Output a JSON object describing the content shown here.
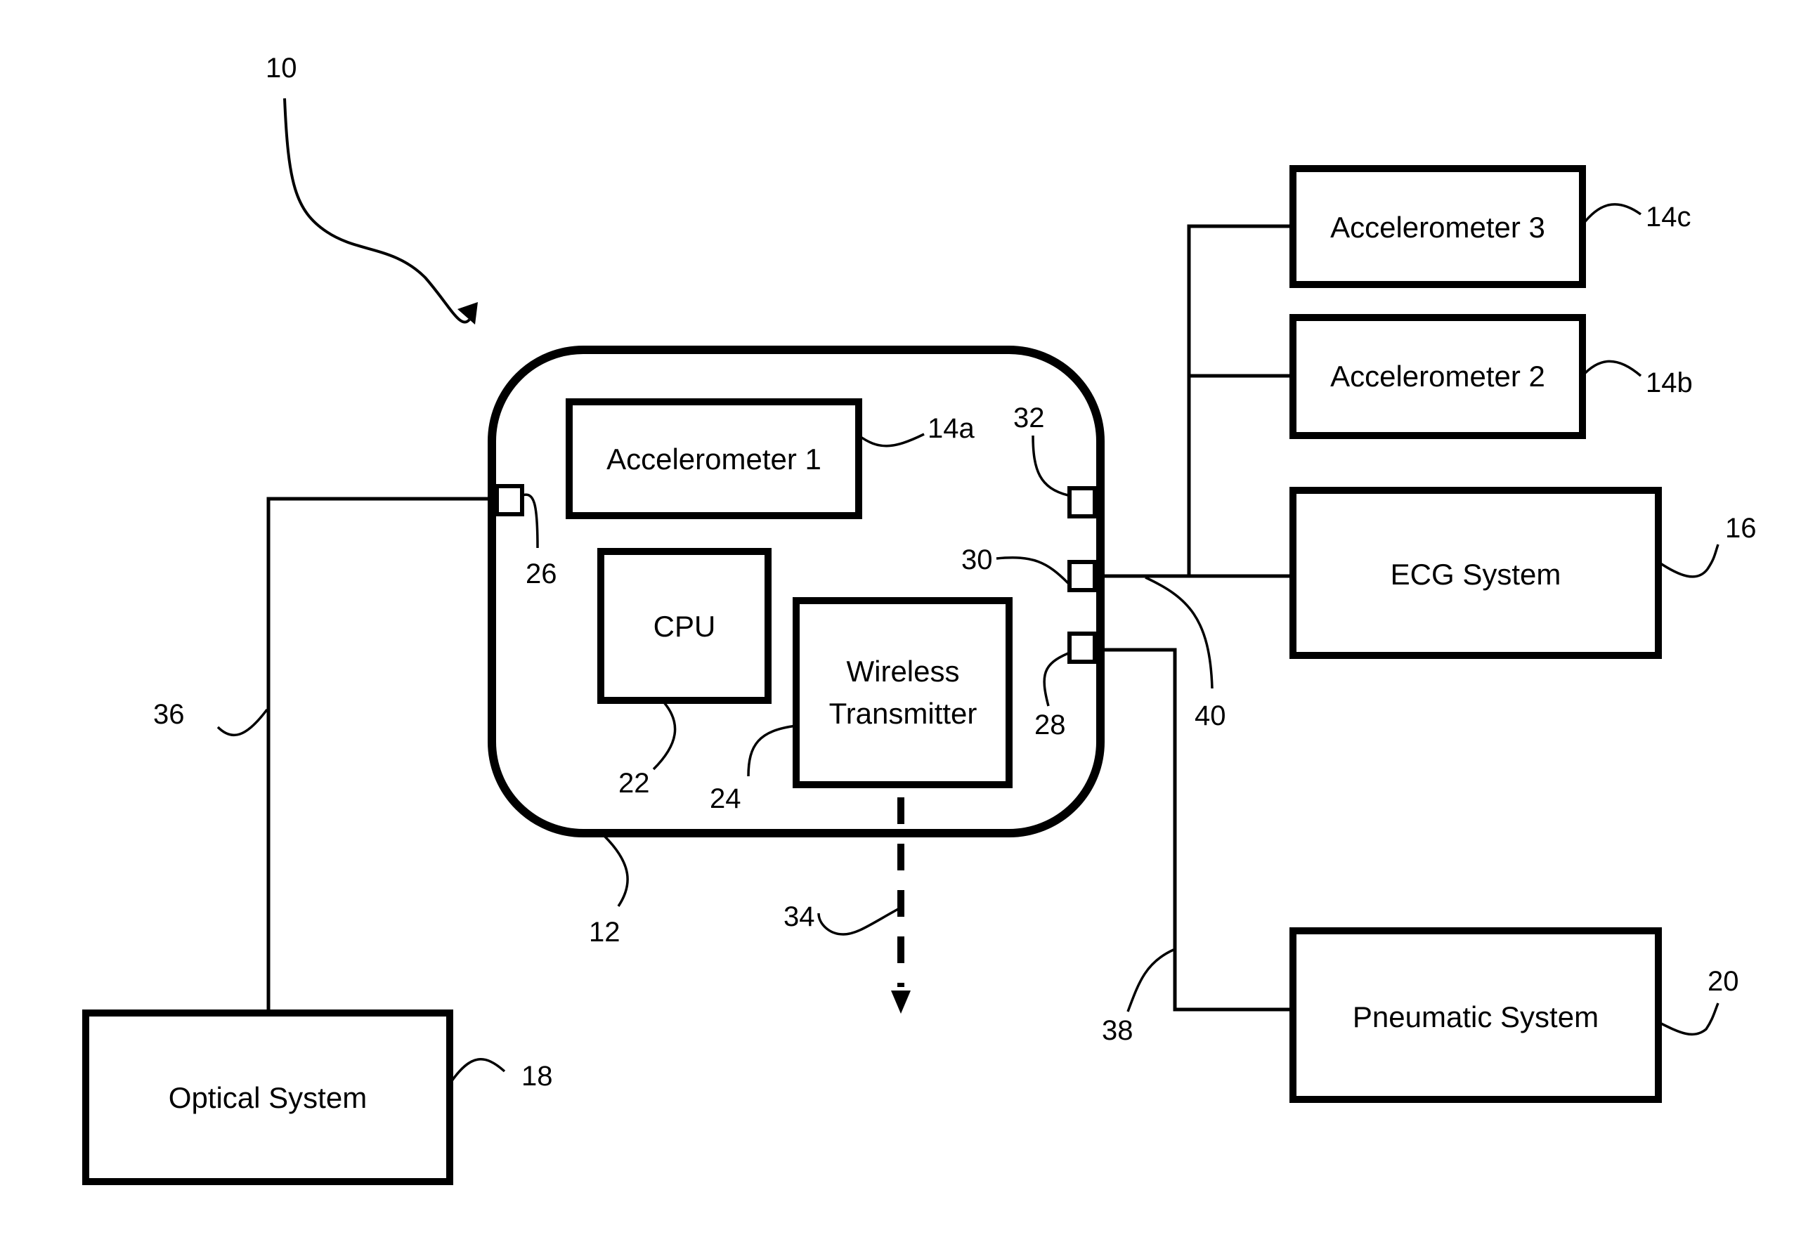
{
  "figure": {
    "system_ref": "10",
    "device": {
      "ref": "12"
    },
    "components": {
      "accel1": {
        "label": "Accelerometer 1",
        "ref": "14a"
      },
      "accel2": {
        "label": "Accelerometer 2",
        "ref": "14b"
      },
      "accel3": {
        "label": "Accelerometer 3",
        "ref": "14c"
      },
      "ecg": {
        "label": "ECG System",
        "ref": "16"
      },
      "optical": {
        "label": "Optical System",
        "ref": "18"
      },
      "pneumatic": {
        "label": "Pneumatic System",
        "ref": "20"
      },
      "cpu": {
        "label": "CPU",
        "ref": "22"
      },
      "wireless": {
        "label_line1": "Wireless",
        "label_line2": "Transmitter",
        "ref": "24"
      }
    },
    "ports": {
      "p26": "26",
      "p28": "28",
      "p30": "30",
      "p32": "32"
    },
    "connections": {
      "wireless_signal": "34",
      "optical_line": "36",
      "pneumatic_line": "38",
      "ecg_line": "40"
    }
  }
}
